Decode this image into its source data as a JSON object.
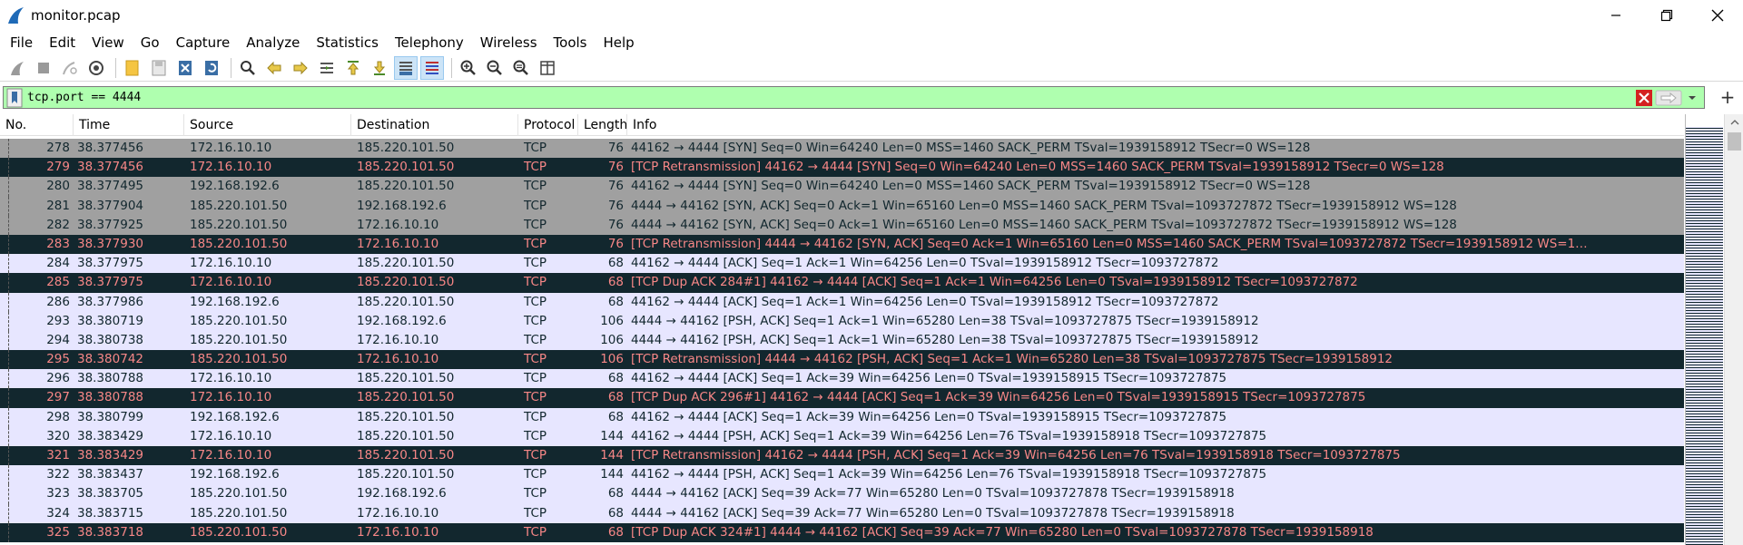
{
  "window": {
    "title": "monitor.pcap"
  },
  "menu": [
    "File",
    "Edit",
    "View",
    "Go",
    "Capture",
    "Analyze",
    "Statistics",
    "Telephony",
    "Wireless",
    "Tools",
    "Help"
  ],
  "filter": {
    "value": "tcp.port == 4444"
  },
  "columns": [
    "No.",
    "Time",
    "Source",
    "Destination",
    "Protocol",
    "Length",
    "Info"
  ],
  "packets": [
    {
      "no": "278",
      "time": "38.377456",
      "src": "172.16.10.10",
      "dst": "185.220.101.50",
      "proto": "TCP",
      "len": "76",
      "info": "44162 → 4444 [SYN] Seq=0 Win=64240 Len=0 MSS=1460 SACK_PERM TSval=1939158912 TSecr=0 WS=128",
      "style": "gray"
    },
    {
      "no": "279",
      "time": "38.377456",
      "src": "172.16.10.10",
      "dst": "185.220.101.50",
      "proto": "TCP",
      "len": "76",
      "info": "[TCP Retransmission] 44162 → 4444 [SYN] Seq=0 Win=64240 Len=0 MSS=1460 SACK_PERM TSval=1939158912 TSecr=0 WS=128",
      "style": "dark"
    },
    {
      "no": "280",
      "time": "38.377495",
      "src": "192.168.192.6",
      "dst": "185.220.101.50",
      "proto": "TCP",
      "len": "76",
      "info": "44162 → 4444 [SYN] Seq=0 Win=64240 Len=0 MSS=1460 SACK_PERM TSval=1939158912 TSecr=0 WS=128",
      "style": "gray"
    },
    {
      "no": "281",
      "time": "38.377904",
      "src": "185.220.101.50",
      "dst": "192.168.192.6",
      "proto": "TCP",
      "len": "76",
      "info": "4444 → 44162 [SYN, ACK] Seq=0 Ack=1 Win=65160 Len=0 MSS=1460 SACK_PERM TSval=1093727872 TSecr=1939158912 WS=128",
      "style": "gray"
    },
    {
      "no": "282",
      "time": "38.377925",
      "src": "185.220.101.50",
      "dst": "172.16.10.10",
      "proto": "TCP",
      "len": "76",
      "info": "4444 → 44162 [SYN, ACK] Seq=0 Ack=1 Win=65160 Len=0 MSS=1460 SACK_PERM TSval=1093727872 TSecr=1939158912 WS=128",
      "style": "gray"
    },
    {
      "no": "283",
      "time": "38.377930",
      "src": "185.220.101.50",
      "dst": "172.16.10.10",
      "proto": "TCP",
      "len": "76",
      "info": "[TCP Retransmission] 4444 → 44162 [SYN, ACK] Seq=0 Ack=1 Win=65160 Len=0 MSS=1460 SACK_PERM TSval=1093727872 TSecr=1939158912 WS=1…",
      "style": "dark"
    },
    {
      "no": "284",
      "time": "38.377975",
      "src": "172.16.10.10",
      "dst": "185.220.101.50",
      "proto": "TCP",
      "len": "68",
      "info": "44162 → 4444 [ACK] Seq=1 Ack=1 Win=64256 Len=0 TSval=1939158912 TSecr=1093727872",
      "style": "light"
    },
    {
      "no": "285",
      "time": "38.377975",
      "src": "172.16.10.10",
      "dst": "185.220.101.50",
      "proto": "TCP",
      "len": "68",
      "info": "[TCP Dup ACK 284#1] 44162 → 4444 [ACK] Seq=1 Ack=1 Win=64256 Len=0 TSval=1939158912 TSecr=1093727872",
      "style": "dark"
    },
    {
      "no": "286",
      "time": "38.377986",
      "src": "192.168.192.6",
      "dst": "185.220.101.50",
      "proto": "TCP",
      "len": "68",
      "info": "44162 → 4444 [ACK] Seq=1 Ack=1 Win=64256 Len=0 TSval=1939158912 TSecr=1093727872",
      "style": "light"
    },
    {
      "no": "293",
      "time": "38.380719",
      "src": "185.220.101.50",
      "dst": "192.168.192.6",
      "proto": "TCP",
      "len": "106",
      "info": "4444 → 44162 [PSH, ACK] Seq=1 Ack=1 Win=65280 Len=38 TSval=1093727875 TSecr=1939158912",
      "style": "light"
    },
    {
      "no": "294",
      "time": "38.380738",
      "src": "185.220.101.50",
      "dst": "172.16.10.10",
      "proto": "TCP",
      "len": "106",
      "info": "4444 → 44162 [PSH, ACK] Seq=1 Ack=1 Win=65280 Len=38 TSval=1093727875 TSecr=1939158912",
      "style": "light"
    },
    {
      "no": "295",
      "time": "38.380742",
      "src": "185.220.101.50",
      "dst": "172.16.10.10",
      "proto": "TCP",
      "len": "106",
      "info": "[TCP Retransmission] 4444 → 44162 [PSH, ACK] Seq=1 Ack=1 Win=65280 Len=38 TSval=1093727875 TSecr=1939158912",
      "style": "dark"
    },
    {
      "no": "296",
      "time": "38.380788",
      "src": "172.16.10.10",
      "dst": "185.220.101.50",
      "proto": "TCP",
      "len": "68",
      "info": "44162 → 4444 [ACK] Seq=1 Ack=39 Win=64256 Len=0 TSval=1939158915 TSecr=1093727875",
      "style": "light"
    },
    {
      "no": "297",
      "time": "38.380788",
      "src": "172.16.10.10",
      "dst": "185.220.101.50",
      "proto": "TCP",
      "len": "68",
      "info": "[TCP Dup ACK 296#1] 44162 → 4444 [ACK] Seq=1 Ack=39 Win=64256 Len=0 TSval=1939158915 TSecr=1093727875",
      "style": "dark"
    },
    {
      "no": "298",
      "time": "38.380799",
      "src": "192.168.192.6",
      "dst": "185.220.101.50",
      "proto": "TCP",
      "len": "68",
      "info": "44162 → 4444 [ACK] Seq=1 Ack=39 Win=64256 Len=0 TSval=1939158915 TSecr=1093727875",
      "style": "light"
    },
    {
      "no": "320",
      "time": "38.383429",
      "src": "172.16.10.10",
      "dst": "185.220.101.50",
      "proto": "TCP",
      "len": "144",
      "info": "44162 → 4444 [PSH, ACK] Seq=1 Ack=39 Win=64256 Len=76 TSval=1939158918 TSecr=1093727875",
      "style": "light"
    },
    {
      "no": "321",
      "time": "38.383429",
      "src": "172.16.10.10",
      "dst": "185.220.101.50",
      "proto": "TCP",
      "len": "144",
      "info": "[TCP Retransmission] 44162 → 4444 [PSH, ACK] Seq=1 Ack=39 Win=64256 Len=76 TSval=1939158918 TSecr=1093727875",
      "style": "dark"
    },
    {
      "no": "322",
      "time": "38.383437",
      "src": "192.168.192.6",
      "dst": "185.220.101.50",
      "proto": "TCP",
      "len": "144",
      "info": "44162 → 4444 [PSH, ACK] Seq=1 Ack=39 Win=64256 Len=76 TSval=1939158918 TSecr=1093727875",
      "style": "light"
    },
    {
      "no": "323",
      "time": "38.383705",
      "src": "185.220.101.50",
      "dst": "192.168.192.6",
      "proto": "TCP",
      "len": "68",
      "info": "4444 → 44162 [ACK] Seq=39 Ack=77 Win=65280 Len=0 TSval=1093727878 TSecr=1939158918",
      "style": "light"
    },
    {
      "no": "324",
      "time": "38.383715",
      "src": "185.220.101.50",
      "dst": "172.16.10.10",
      "proto": "TCP",
      "len": "68",
      "info": "4444 → 44162 [ACK] Seq=39 Ack=77 Win=65280 Len=0 TSval=1093727878 TSecr=1939158918",
      "style": "light"
    },
    {
      "no": "325",
      "time": "38.383718",
      "src": "185.220.101.50",
      "dst": "172.16.10.10",
      "proto": "TCP",
      "len": "68",
      "info": "[TCP Dup ACK 324#1] 4444 → 44162 [ACK] Seq=39 Ack=77 Win=65280 Len=0 TSval=1093727878 TSecr=1939158918",
      "style": "dark"
    }
  ],
  "colors": {
    "filter_valid": "#afffaf",
    "row_gray": "#a0a0a0",
    "row_dark": "#12272e",
    "row_dark_text": "#f78787",
    "row_light": "#e7e6ff"
  }
}
